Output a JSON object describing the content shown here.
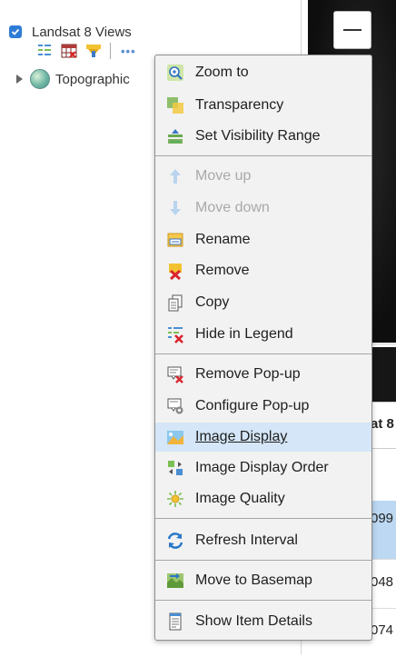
{
  "panel": {
    "layer": {
      "title": "Landsat 8 Views",
      "checked": true
    },
    "tools": [
      "legend-list-icon",
      "table-x-icon",
      "filter-icon",
      "more-icon"
    ],
    "more_label": "•••",
    "basemap": {
      "title": "Topographic"
    }
  },
  "map": {
    "zoom_out_icon": "minus-icon"
  },
  "table": {
    "header": "at 8",
    "rows": [
      "099",
      "048",
      "074"
    ]
  },
  "menu": {
    "highlighted": "Image Display",
    "items": [
      {
        "label": "Zoom to",
        "icon": "zoom-to-icon"
      },
      {
        "label": "Transparency",
        "icon": "transparency-icon"
      },
      {
        "label": "Set Visibility Range",
        "icon": "visibility-range-icon"
      },
      {
        "label": "Move up",
        "icon": "arrow-up-icon",
        "disabled": true
      },
      {
        "label": "Move down",
        "icon": "arrow-down-icon",
        "disabled": true
      },
      {
        "label": "Rename",
        "icon": "rename-icon"
      },
      {
        "label": "Remove",
        "icon": "remove-icon"
      },
      {
        "label": "Copy",
        "icon": "copy-icon"
      },
      {
        "label": "Hide in Legend",
        "icon": "hide-in-legend-icon"
      },
      {
        "label": "Remove Pop-up",
        "icon": "remove-popup-icon"
      },
      {
        "label": "Configure Pop-up",
        "icon": "configure-popup-icon"
      },
      {
        "label": "Image Display",
        "icon": "image-display-icon"
      },
      {
        "label": "Image Display Order",
        "icon": "image-display-order-icon"
      },
      {
        "label": "Image Quality",
        "icon": "image-quality-icon"
      },
      {
        "label": "Refresh Interval",
        "icon": "refresh-interval-icon"
      },
      {
        "label": "Move to Basemap",
        "icon": "move-to-basemap-icon"
      },
      {
        "label": "Show Item Details",
        "icon": "item-details-icon"
      }
    ]
  }
}
